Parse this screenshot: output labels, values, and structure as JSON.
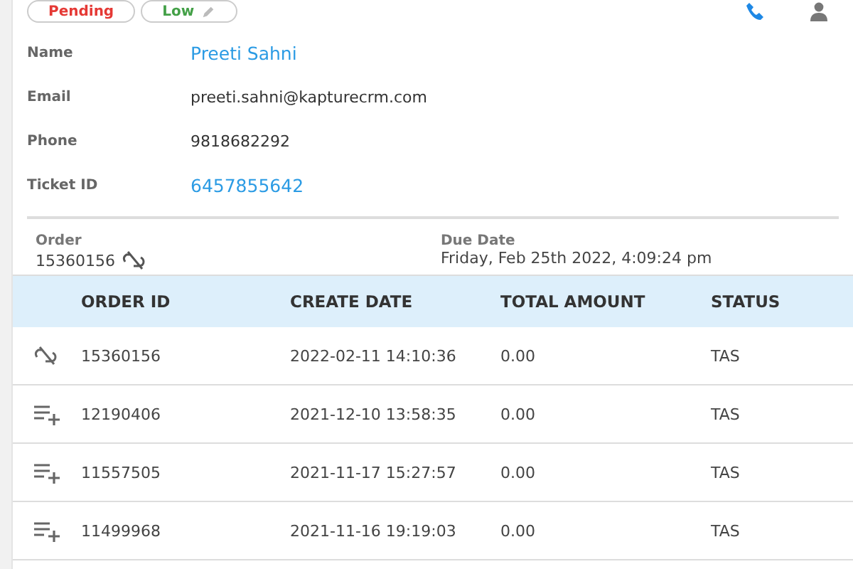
{
  "tags": [
    {
      "label": "Pending",
      "color": "#e53935"
    },
    {
      "label": "Low",
      "color": "#43a047"
    }
  ],
  "fields": [
    {
      "label": "Name",
      "value": "Preeti Sahni",
      "link": true
    },
    {
      "label": "Email",
      "value": "preeti.sahni@kapturecrm.com",
      "link": false
    },
    {
      "label": "Phone",
      "value": "9818682292",
      "link": false
    },
    {
      "label": "Ticket ID",
      "value": "6457855642",
      "link": true
    }
  ],
  "order": {
    "label": "Order",
    "value": "15360156",
    "due_label": "Due Date",
    "due_value": "Friday, Feb 25th 2022, 4:09:24 pm"
  },
  "table": {
    "columns": [
      "ORDER ID",
      "CREATE DATE",
      "TOTAL AMOUNT",
      "STATUS"
    ],
    "rows": [
      {
        "kind": "unlink",
        "cells": [
          "15360156",
          "2022-02-11 14:10:36",
          "0.00",
          "TAS"
        ]
      },
      {
        "kind": "add",
        "cells": [
          "12190406",
          "2021-12-10 13:58:35",
          "0.00",
          "TAS"
        ]
      },
      {
        "kind": "add",
        "cells": [
          "11557505",
          "2021-11-17 15:27:57",
          "0.00",
          "TAS"
        ]
      },
      {
        "kind": "add",
        "cells": [
          "11499968",
          "2021-11-16 19:19:03",
          "0.00",
          "TAS"
        ]
      }
    ]
  }
}
